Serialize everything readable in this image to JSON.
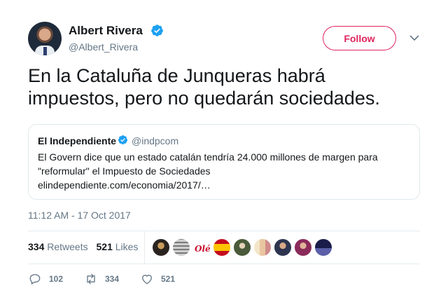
{
  "author": {
    "name": "Albert Rivera",
    "handle": "@Albert_Rivera",
    "verified_icon": "verified-badge-icon"
  },
  "header": {
    "follow_label": "Follow",
    "menu_icon": "chevron-down-icon"
  },
  "tweet": {
    "text_line1": "En la Cataluña de Junqueras habrá",
    "text_line2": "impuestos, pero no quedarán sociedades."
  },
  "quoted": {
    "name": "El Independiente",
    "handle": "@indpcom",
    "text_line1": "El Govern dice que un estado catalán tendría 24.000 millones de margen para",
    "text_line2": "\"reformular\" el Impuesto de Sociedades",
    "link": "elindependiente.com/economia/2017/…"
  },
  "timestamp": "11:12 AM - 17 Oct 2017",
  "stats": {
    "retweets_count": "334",
    "retweets_label": "Retweets",
    "likes_count": "521",
    "likes_label": "Likes"
  },
  "actions": {
    "reply_count": "102",
    "retweet_count": "334",
    "like_count": "521"
  },
  "colors": {
    "accent": "#e0245e",
    "verified": "#1da1f2",
    "muted": "#657786"
  }
}
